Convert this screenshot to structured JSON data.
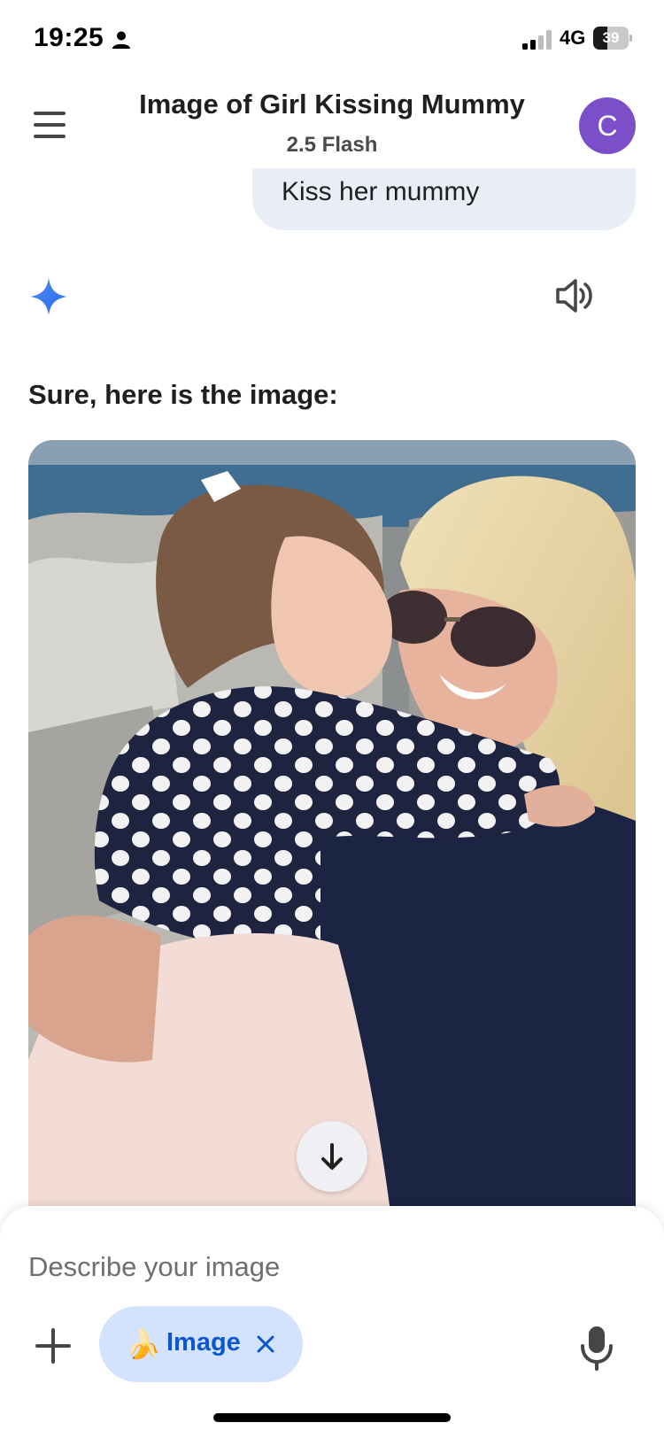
{
  "status_bar": {
    "time": "19:25",
    "network": "4G",
    "battery_level": "39",
    "battery_fraction": 0.39
  },
  "header": {
    "title": "Image of Girl Kissing Mummy",
    "model": "2.5 Flash",
    "avatar_initial": "C"
  },
  "conversation": {
    "user_message": "Kiss her mummy",
    "response_text": "Sure, here is the image:"
  },
  "composer": {
    "placeholder": "Describe your image",
    "tool_chip_label": "Image",
    "tool_chip_emoji": "🍌"
  },
  "icons": {
    "menu": "hamburger-menu-icon",
    "gemini": "gemini-sparkle-icon",
    "speaker": "speaker-icon",
    "scroll_down": "arrow-down-icon",
    "add": "plus-icon",
    "close": "close-icon",
    "mic": "microphone-icon"
  },
  "colors": {
    "avatar_bg": "#7b4fc7",
    "bubble_bg": "#e9eef6",
    "chip_bg": "#d3e3fd",
    "chip_text": "#0b57d0",
    "gemini_blue": "#4a86f7"
  }
}
